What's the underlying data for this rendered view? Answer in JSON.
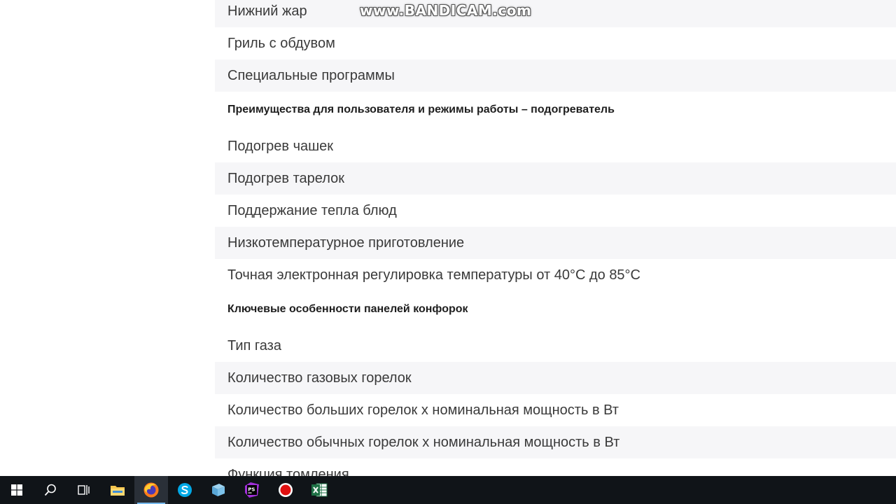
{
  "watermark": "www.BANDICAM.com",
  "spec_rows": [
    {
      "label": "Нижний жар",
      "kind": "item",
      "shaded": true
    },
    {
      "label": "Гриль с обдувом",
      "kind": "item",
      "shaded": false
    },
    {
      "label": "Специальные программы",
      "kind": "item",
      "shaded": true
    },
    {
      "label": "Преимущества для пользователя и режимы работы – подогреватель",
      "kind": "header",
      "shaded": false
    },
    {
      "label": "Подогрев чашек",
      "kind": "item",
      "shaded": false
    },
    {
      "label": "Подогрев тарелок",
      "kind": "item",
      "shaded": true
    },
    {
      "label": "Поддержание тепла блюд",
      "kind": "item",
      "shaded": false
    },
    {
      "label": "Низкотемпературное приготовление",
      "kind": "item",
      "shaded": true
    },
    {
      "label": "Точная электронная регулировка температуры от 40°C до 85°C",
      "kind": "item",
      "shaded": false
    },
    {
      "label": "Ключевые особенности панелей конфорок",
      "kind": "header",
      "shaded": false
    },
    {
      "label": "Тип газа",
      "kind": "item",
      "shaded": false
    },
    {
      "label": "Количество газовых горелок",
      "kind": "item",
      "shaded": true
    },
    {
      "label": "Количество больших горелок x номинальная мощность в Вт",
      "kind": "item",
      "shaded": false
    },
    {
      "label": "Количество обычных горелок x номинальная мощность в Вт",
      "kind": "item",
      "shaded": true
    },
    {
      "label": "Функция томления",
      "kind": "item",
      "shaded": false
    }
  ],
  "taskbar": {
    "buttons": [
      {
        "name": "start-button",
        "icon": "windows-logo-icon"
      },
      {
        "name": "search-button",
        "icon": "search-icon"
      },
      {
        "name": "task-view-button",
        "icon": "task-view-icon"
      },
      {
        "name": "file-explorer-button",
        "icon": "folder-icon"
      },
      {
        "name": "firefox-button",
        "icon": "firefox-icon",
        "active": true
      },
      {
        "name": "skype-button",
        "icon": "skype-icon"
      },
      {
        "name": "notepad-button",
        "icon": "notepad-icon"
      },
      {
        "name": "phpstorm-button",
        "icon": "phpstorm-icon"
      },
      {
        "name": "bandicam-button",
        "icon": "record-icon"
      },
      {
        "name": "excel-button",
        "icon": "excel-icon"
      }
    ],
    "colors": {
      "bar": "#101418",
      "active": "#2a3038",
      "indicator": "#76b9ed"
    }
  }
}
